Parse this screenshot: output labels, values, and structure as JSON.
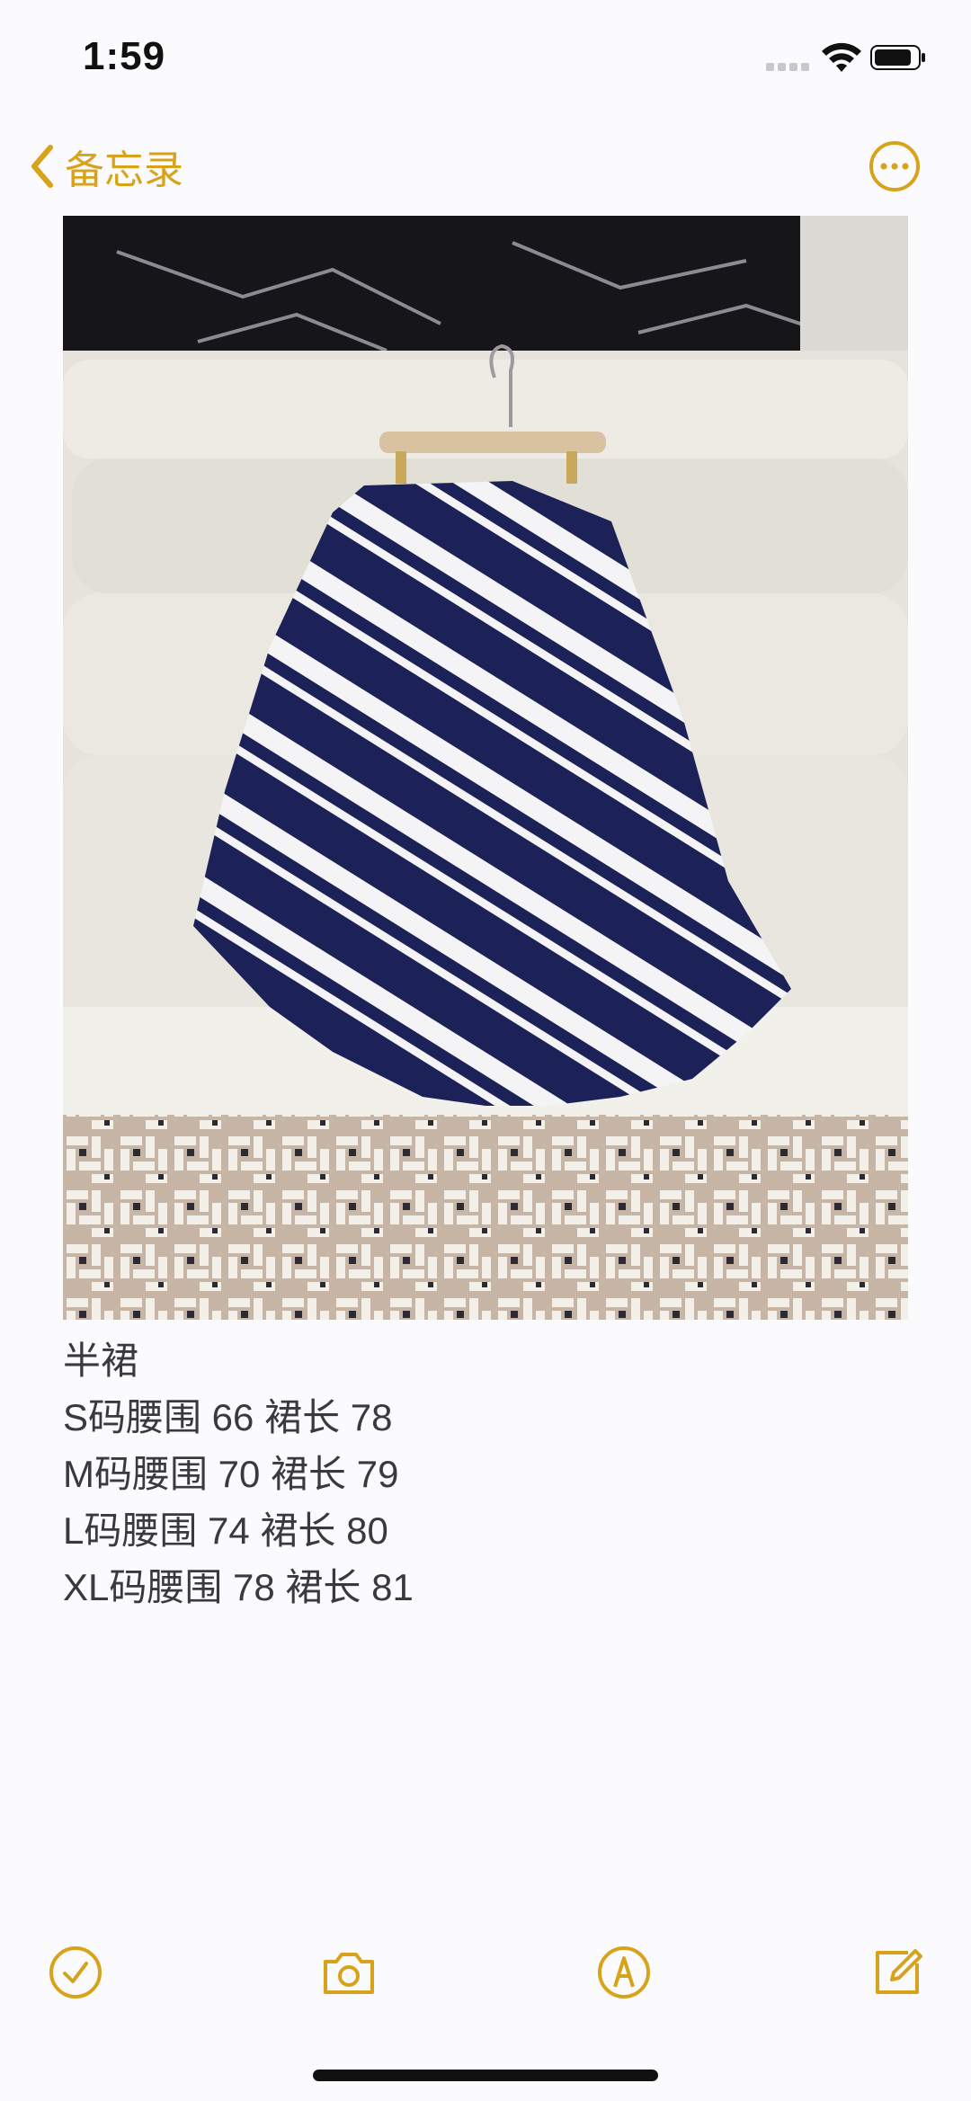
{
  "status_bar": {
    "time": "1:59",
    "signal_icon": "cellular-signal-icon",
    "wifi_icon": "wifi-icon",
    "battery_icon": "battery-icon"
  },
  "nav": {
    "back_label": "备忘录",
    "back_icon": "chevron-left-icon",
    "more_icon": "ellipsis-circle-icon",
    "accent_color": "#d8a31a"
  },
  "note": {
    "image_description": "navy-and-white diagonal striped midi skirt on hanger, sofa, patterned rug",
    "lines": [
      "半裙",
      "S码腰围 66 裙长 78",
      "M码腰围 70 裙长 79",
      "L码腰围 74 裙长 80",
      "XL码腰围 78 裙长 81"
    ]
  },
  "toolbar": {
    "icons": [
      "checklist-icon",
      "camera-icon",
      "markup-pen-icon",
      "compose-icon"
    ]
  }
}
